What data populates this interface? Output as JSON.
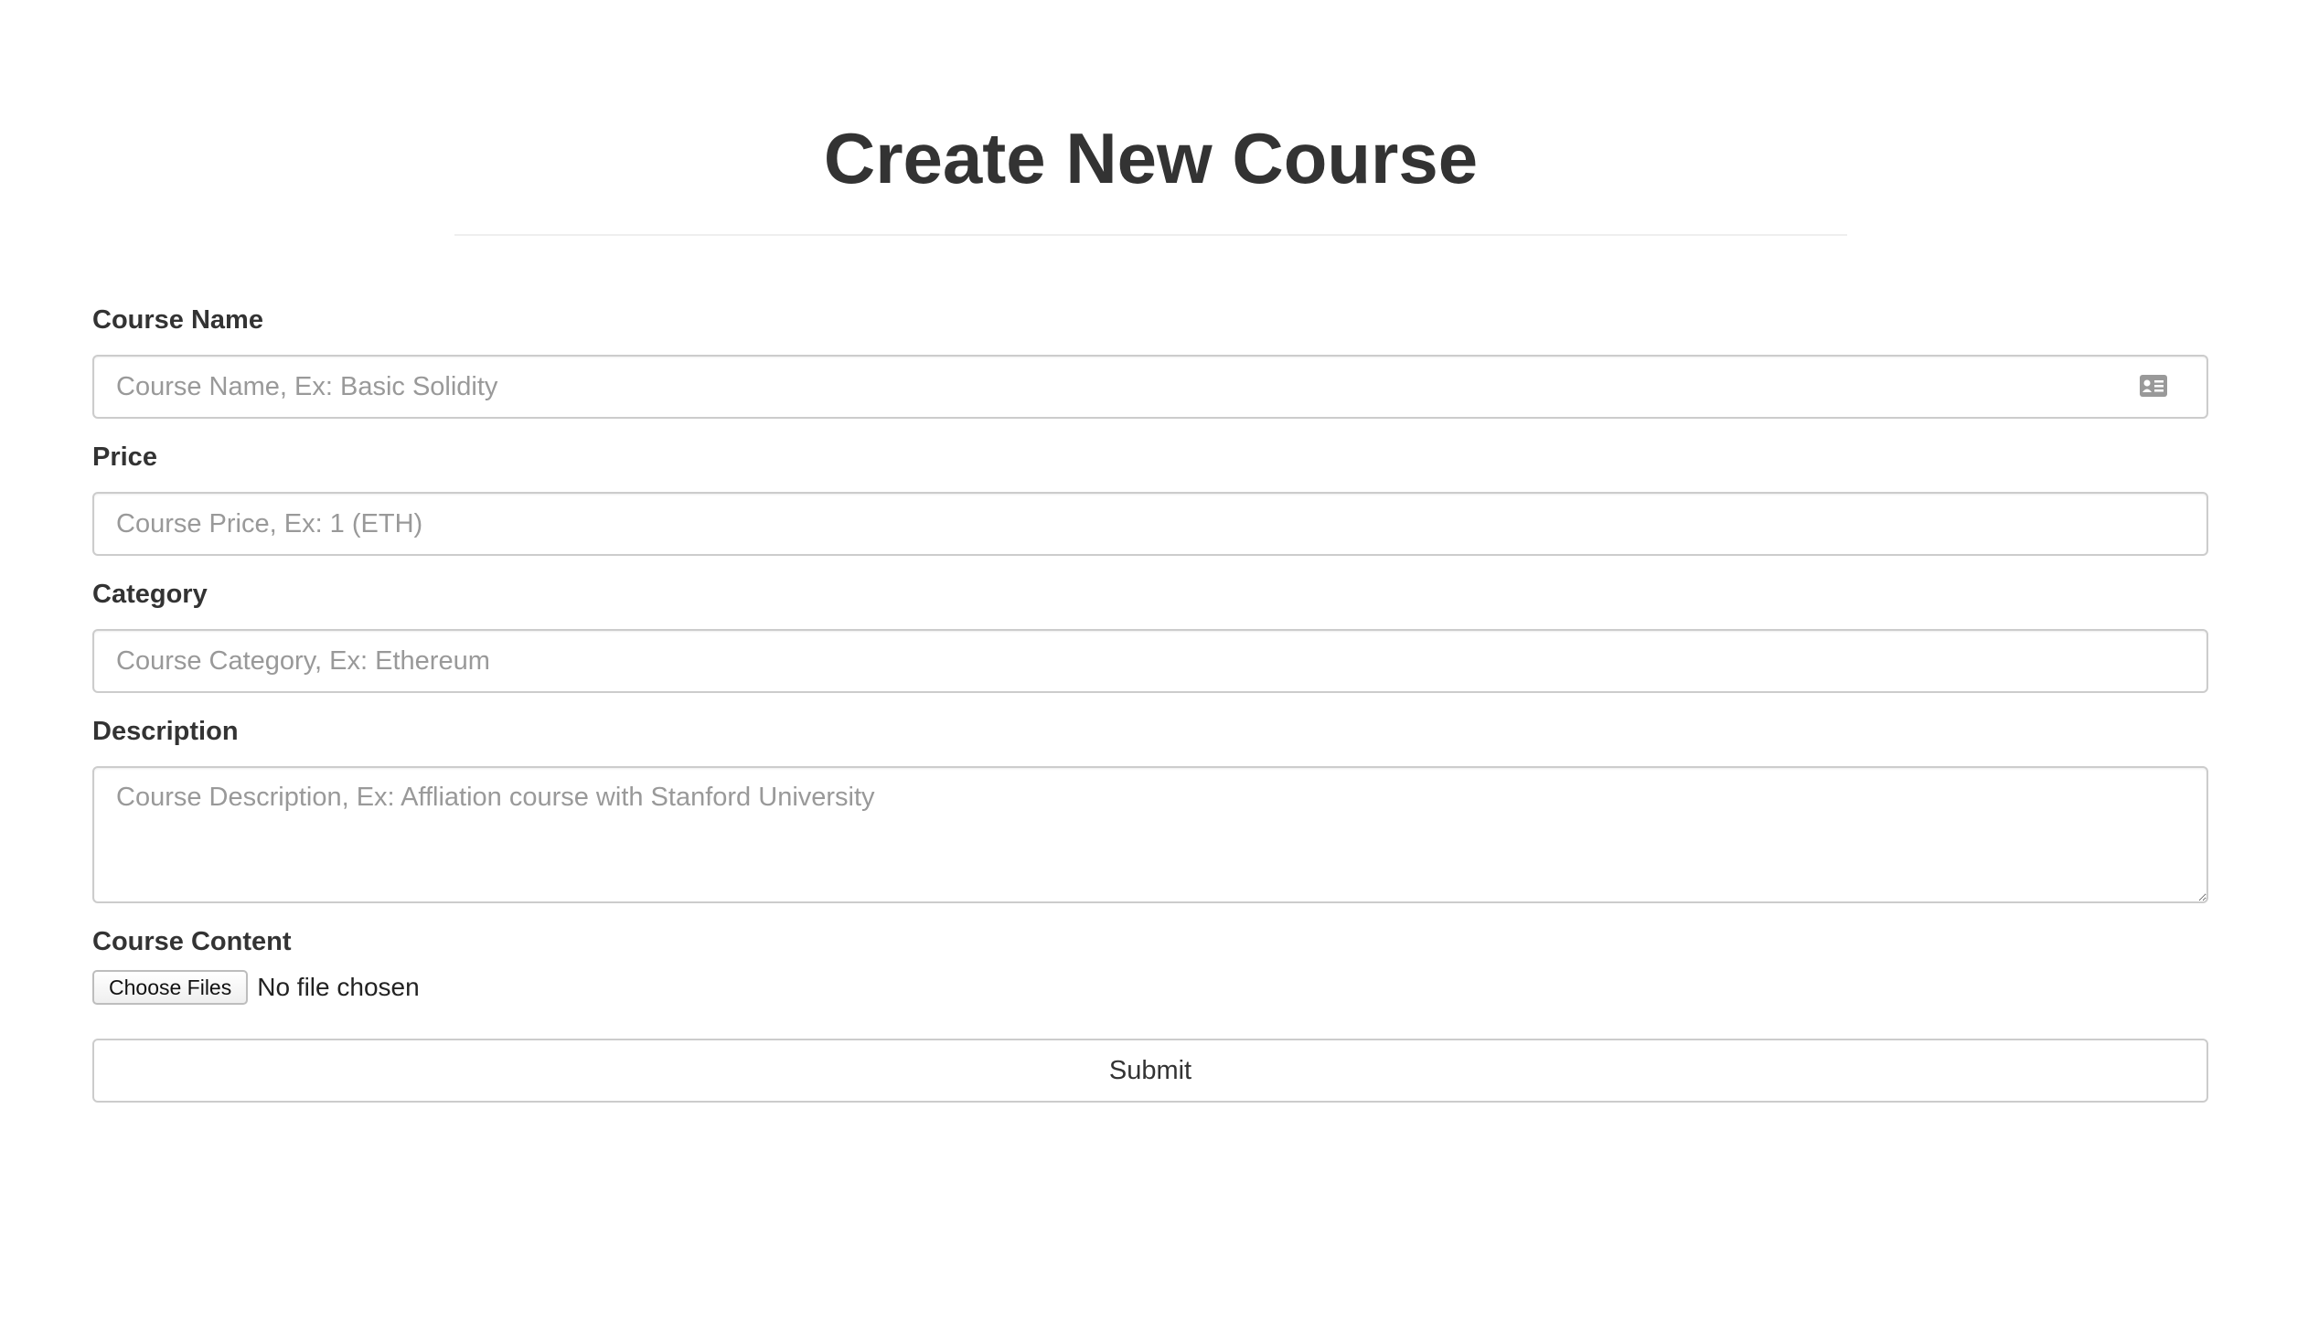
{
  "header": {
    "title": "Create New Course"
  },
  "form": {
    "course_name": {
      "label": "Course Name",
      "value": "",
      "placeholder": "Course Name, Ex: Basic Solidity",
      "icon": "contact-card-icon"
    },
    "price": {
      "label": "Price",
      "value": "",
      "placeholder": "Course Price, Ex: 1 (ETH)"
    },
    "category": {
      "label": "Category",
      "value": "",
      "placeholder": "Course Category, Ex: Ethereum"
    },
    "description": {
      "label": "Description",
      "value": "",
      "placeholder": "Course Description, Ex: Affliation course with Stanford University"
    },
    "content": {
      "label": "Course Content",
      "button_label": "Choose Files",
      "status": "No file chosen"
    },
    "submit_label": "Submit"
  },
  "colors": {
    "text": "#333333",
    "placeholder": "#999999",
    "border": "#cccccc",
    "divider": "#eeeeee",
    "icon": "#999999"
  }
}
